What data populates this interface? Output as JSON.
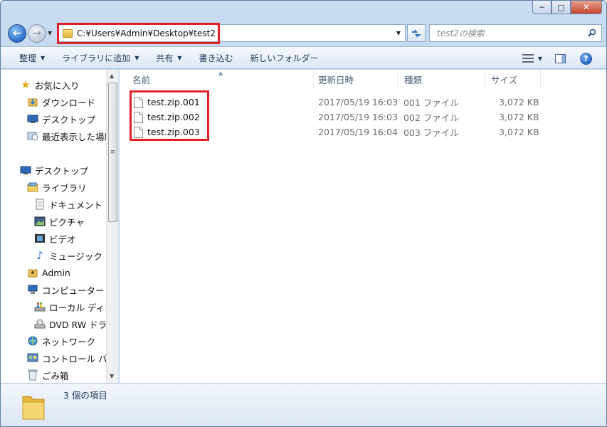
{
  "window": {
    "caption_buttons": {
      "minimize": "─",
      "maximize": "□",
      "close": "✕"
    }
  },
  "nav": {
    "back_glyph": "←",
    "forward_glyph": "→",
    "address": "C:¥Users¥Admin¥Desktop¥test2",
    "search_placeholder": "test2の検索",
    "icons": [
      "back-arrow-icon",
      "forward-arrow-icon",
      "folder-icon",
      "refresh-icon",
      "search-icon"
    ]
  },
  "toolbar": {
    "organize": "整理",
    "add_to_library": "ライブラリに追加",
    "share": "共有",
    "burn": "書き込む",
    "new_folder": "新しいフォルダー",
    "help": "?"
  },
  "sidebar": {
    "items": [
      {
        "label": "お気に入り",
        "icon": "star-icon"
      },
      {
        "label": "ダウンロード",
        "icon": "downloads-folder-icon"
      },
      {
        "label": "デスクトップ",
        "icon": "desktop-icon"
      },
      {
        "label": "最近表示した場所",
        "icon": "recent-places-icon"
      },
      {
        "label": "デスクトップ",
        "icon": "desktop-icon"
      },
      {
        "label": "ライブラリ",
        "icon": "library-icon"
      },
      {
        "label": "ドキュメント",
        "icon": "document-icon"
      },
      {
        "label": "ピクチャ",
        "icon": "pictures-icon"
      },
      {
        "label": "ビデオ",
        "icon": "video-icon"
      },
      {
        "label": "ミュージック",
        "icon": "music-icon"
      },
      {
        "label": "Admin",
        "icon": "user-folder-icon"
      },
      {
        "label": "コンピューター",
        "icon": "computer-icon"
      },
      {
        "label": "ローカル ディスク",
        "icon": "local-disk-icon"
      },
      {
        "label": "DVD RW ドライブ",
        "icon": "dvd-drive-icon"
      },
      {
        "label": "ネットワーク",
        "icon": "network-icon"
      },
      {
        "label": "コントロール パネル",
        "icon": "control-panel-icon"
      },
      {
        "label": "ごみ箱",
        "icon": "recycle-bin-icon"
      }
    ]
  },
  "columns": {
    "name": "名前",
    "modified": "更新日時",
    "type": "種類",
    "size": "サイズ"
  },
  "files": [
    {
      "name": "test.zip.001",
      "modified": "2017/05/19 16:03",
      "type": "001 ファイル",
      "size": "3,072 KB"
    },
    {
      "name": "test.zip.002",
      "modified": "2017/05/19 16:03",
      "type": "002 ファイル",
      "size": "3,072 KB"
    },
    {
      "name": "test.zip.003",
      "modified": "2017/05/19 16:04",
      "type": "003 ファイル",
      "size": "3,072 KB"
    }
  ],
  "details": {
    "item_count": "3 個の項目"
  },
  "colors": {
    "highlight": "#e0202a",
    "chrome": "#c9dcf1",
    "toolbar_text": "#1e395b"
  }
}
